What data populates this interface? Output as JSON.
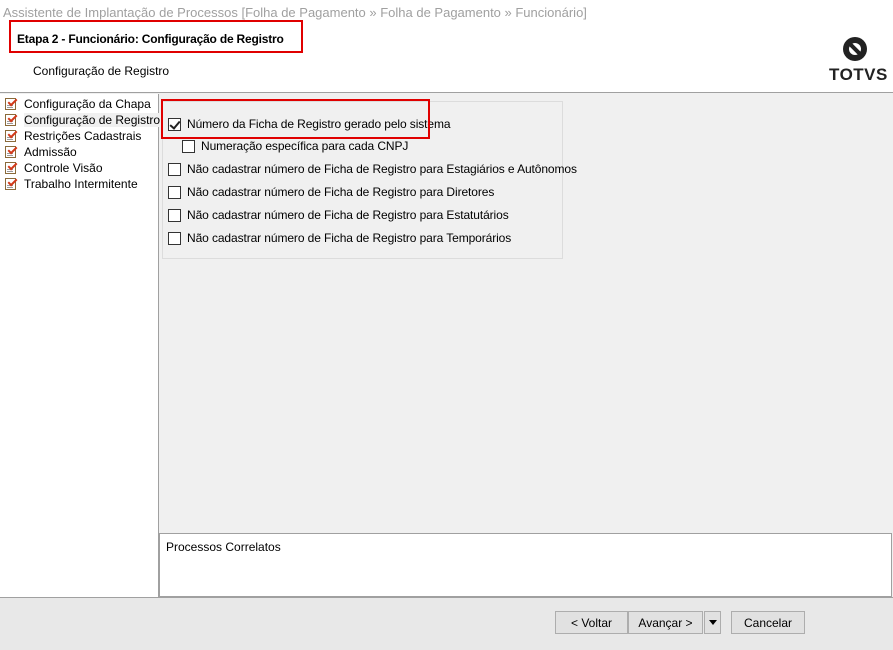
{
  "window": {
    "title": "Assistente de Implantação de Processos [Folha de Pagamento » Folha de Pagamento » Funcionário]"
  },
  "header": {
    "step_title": "Etapa 2 - Funcionário: Configuração de Registro",
    "step_subtitle": "Configuração de Registro",
    "logo_text": "TOTVS",
    "highlight_color": "#e00000"
  },
  "sidebar": {
    "items": [
      {
        "label": "Configuração da Chapa",
        "icon": "checklist-icon"
      },
      {
        "label": "Configuração de Registro",
        "icon": "checklist-icon",
        "selected": true
      },
      {
        "label": "Restrições Cadastrais",
        "icon": "checklist-icon"
      },
      {
        "label": "Admissão",
        "icon": "checklist-icon"
      },
      {
        "label": "Controle Visão",
        "icon": "checklist-icon"
      },
      {
        "label": "Trabalho Intermitente",
        "icon": "checklist-icon"
      }
    ]
  },
  "options": [
    {
      "label": "Número da Ficha de Registro gerado pelo sistema",
      "checked": true
    },
    {
      "label": "Numeração específica para cada CNPJ",
      "checked": false
    },
    {
      "label": "Não cadastrar número de Ficha de Registro para Estagiários e Autônomos",
      "checked": false
    },
    {
      "label": "Não cadastrar número de Ficha de Registro para Diretores",
      "checked": false
    },
    {
      "label": "Não cadastrar número de Ficha de Registro para Estatutários",
      "checked": false
    },
    {
      "label": "Não cadastrar número de Ficha de Registro para Temporários",
      "checked": false
    }
  ],
  "correlated": {
    "title": "Processos Correlatos"
  },
  "footer": {
    "back_label": "< Voltar",
    "next_label": "Avançar >",
    "cancel_label": "Cancelar"
  }
}
